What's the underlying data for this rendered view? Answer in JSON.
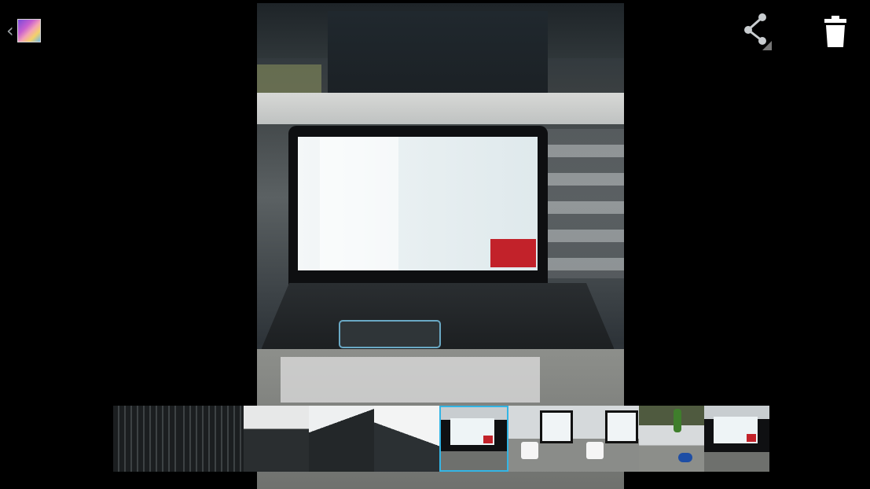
{
  "app": {
    "name": "Gallery",
    "icon": "gallery-app-icon",
    "up_icon": "chevron-left-icon"
  },
  "actions": [
    {
      "name": "share",
      "icon": "share-icon"
    },
    {
      "name": "delete",
      "icon": "trash-icon"
    }
  ],
  "photo": {
    "description": "photo"
  },
  "filmstrip": {
    "selected_index": 5,
    "accent_color": "#33b5e5",
    "count": 10
  }
}
